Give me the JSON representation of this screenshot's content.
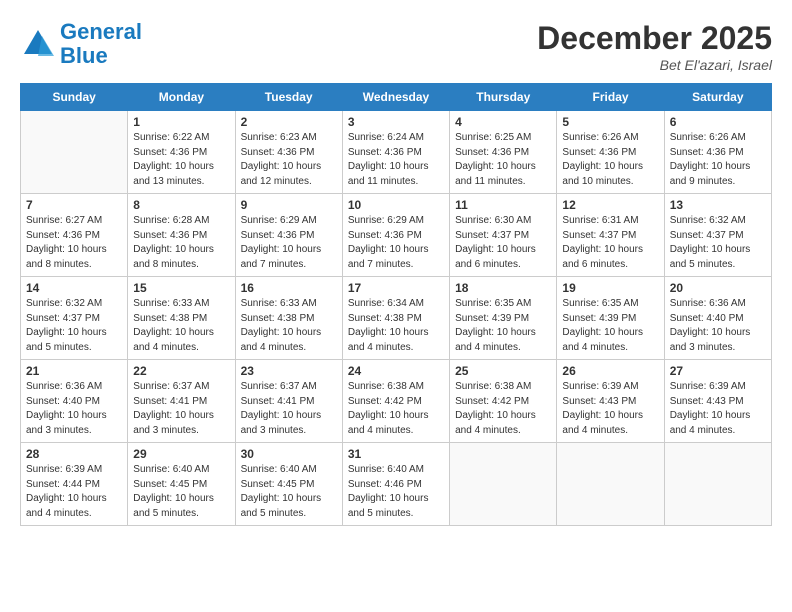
{
  "logo": {
    "line1": "General",
    "line2": "Blue"
  },
  "header": {
    "month": "December 2025",
    "location": "Bet El'azari, Israel"
  },
  "days_of_week": [
    "Sunday",
    "Monday",
    "Tuesday",
    "Wednesday",
    "Thursday",
    "Friday",
    "Saturday"
  ],
  "weeks": [
    [
      {
        "day": "",
        "info": ""
      },
      {
        "day": "1",
        "info": "Sunrise: 6:22 AM\nSunset: 4:36 PM\nDaylight: 10 hours\nand 13 minutes."
      },
      {
        "day": "2",
        "info": "Sunrise: 6:23 AM\nSunset: 4:36 PM\nDaylight: 10 hours\nand 12 minutes."
      },
      {
        "day": "3",
        "info": "Sunrise: 6:24 AM\nSunset: 4:36 PM\nDaylight: 10 hours\nand 11 minutes."
      },
      {
        "day": "4",
        "info": "Sunrise: 6:25 AM\nSunset: 4:36 PM\nDaylight: 10 hours\nand 11 minutes."
      },
      {
        "day": "5",
        "info": "Sunrise: 6:26 AM\nSunset: 4:36 PM\nDaylight: 10 hours\nand 10 minutes."
      },
      {
        "day": "6",
        "info": "Sunrise: 6:26 AM\nSunset: 4:36 PM\nDaylight: 10 hours\nand 9 minutes."
      }
    ],
    [
      {
        "day": "7",
        "info": "Sunrise: 6:27 AM\nSunset: 4:36 PM\nDaylight: 10 hours\nand 8 minutes."
      },
      {
        "day": "8",
        "info": "Sunrise: 6:28 AM\nSunset: 4:36 PM\nDaylight: 10 hours\nand 8 minutes."
      },
      {
        "day": "9",
        "info": "Sunrise: 6:29 AM\nSunset: 4:36 PM\nDaylight: 10 hours\nand 7 minutes."
      },
      {
        "day": "10",
        "info": "Sunrise: 6:29 AM\nSunset: 4:36 PM\nDaylight: 10 hours\nand 7 minutes."
      },
      {
        "day": "11",
        "info": "Sunrise: 6:30 AM\nSunset: 4:37 PM\nDaylight: 10 hours\nand 6 minutes."
      },
      {
        "day": "12",
        "info": "Sunrise: 6:31 AM\nSunset: 4:37 PM\nDaylight: 10 hours\nand 6 minutes."
      },
      {
        "day": "13",
        "info": "Sunrise: 6:32 AM\nSunset: 4:37 PM\nDaylight: 10 hours\nand 5 minutes."
      }
    ],
    [
      {
        "day": "14",
        "info": "Sunrise: 6:32 AM\nSunset: 4:37 PM\nDaylight: 10 hours\nand 5 minutes."
      },
      {
        "day": "15",
        "info": "Sunrise: 6:33 AM\nSunset: 4:38 PM\nDaylight: 10 hours\nand 4 minutes."
      },
      {
        "day": "16",
        "info": "Sunrise: 6:33 AM\nSunset: 4:38 PM\nDaylight: 10 hours\nand 4 minutes."
      },
      {
        "day": "17",
        "info": "Sunrise: 6:34 AM\nSunset: 4:38 PM\nDaylight: 10 hours\nand 4 minutes."
      },
      {
        "day": "18",
        "info": "Sunrise: 6:35 AM\nSunset: 4:39 PM\nDaylight: 10 hours\nand 4 minutes."
      },
      {
        "day": "19",
        "info": "Sunrise: 6:35 AM\nSunset: 4:39 PM\nDaylight: 10 hours\nand 4 minutes."
      },
      {
        "day": "20",
        "info": "Sunrise: 6:36 AM\nSunset: 4:40 PM\nDaylight: 10 hours\nand 3 minutes."
      }
    ],
    [
      {
        "day": "21",
        "info": "Sunrise: 6:36 AM\nSunset: 4:40 PM\nDaylight: 10 hours\nand 3 minutes."
      },
      {
        "day": "22",
        "info": "Sunrise: 6:37 AM\nSunset: 4:41 PM\nDaylight: 10 hours\nand 3 minutes."
      },
      {
        "day": "23",
        "info": "Sunrise: 6:37 AM\nSunset: 4:41 PM\nDaylight: 10 hours\nand 3 minutes."
      },
      {
        "day": "24",
        "info": "Sunrise: 6:38 AM\nSunset: 4:42 PM\nDaylight: 10 hours\nand 4 minutes."
      },
      {
        "day": "25",
        "info": "Sunrise: 6:38 AM\nSunset: 4:42 PM\nDaylight: 10 hours\nand 4 minutes."
      },
      {
        "day": "26",
        "info": "Sunrise: 6:39 AM\nSunset: 4:43 PM\nDaylight: 10 hours\nand 4 minutes."
      },
      {
        "day": "27",
        "info": "Sunrise: 6:39 AM\nSunset: 4:43 PM\nDaylight: 10 hours\nand 4 minutes."
      }
    ],
    [
      {
        "day": "28",
        "info": "Sunrise: 6:39 AM\nSunset: 4:44 PM\nDaylight: 10 hours\nand 4 minutes."
      },
      {
        "day": "29",
        "info": "Sunrise: 6:40 AM\nSunset: 4:45 PM\nDaylight: 10 hours\nand 5 minutes."
      },
      {
        "day": "30",
        "info": "Sunrise: 6:40 AM\nSunset: 4:45 PM\nDaylight: 10 hours\nand 5 minutes."
      },
      {
        "day": "31",
        "info": "Sunrise: 6:40 AM\nSunset: 4:46 PM\nDaylight: 10 hours\nand 5 minutes."
      },
      {
        "day": "",
        "info": ""
      },
      {
        "day": "",
        "info": ""
      },
      {
        "day": "",
        "info": ""
      }
    ]
  ]
}
